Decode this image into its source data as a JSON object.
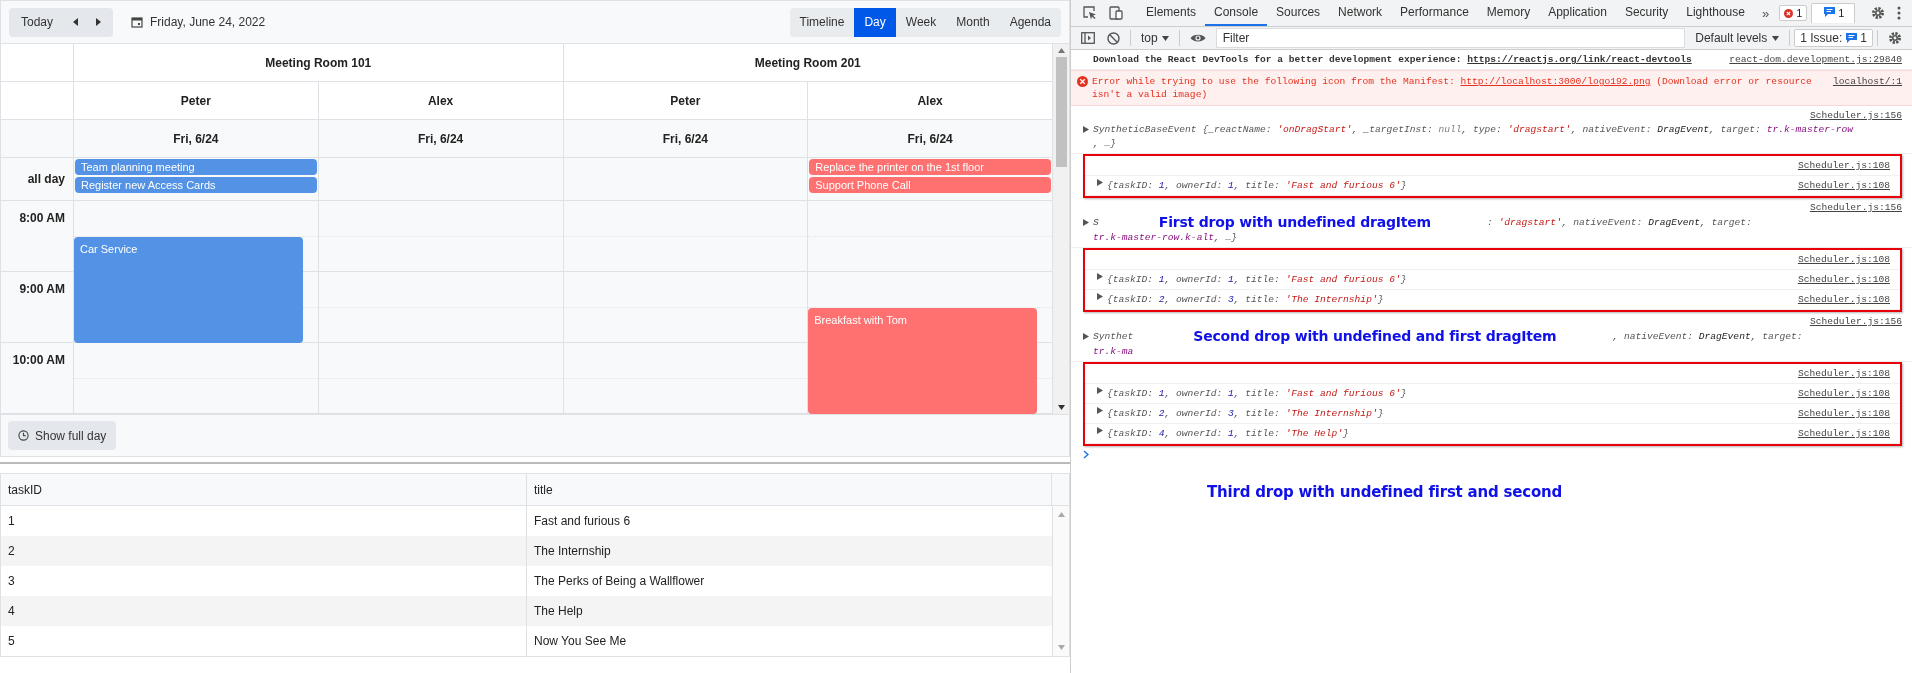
{
  "toolbar": {
    "today": "Today",
    "date": "Friday, June 24, 2022",
    "views": [
      {
        "label": "Timeline",
        "selected": false
      },
      {
        "label": "Day",
        "selected": true
      },
      {
        "label": "Week",
        "selected": false
      },
      {
        "label": "Month",
        "selected": false
      },
      {
        "label": "Agenda",
        "selected": false
      }
    ]
  },
  "scheduler": {
    "rooms": [
      "Meeting Room 101",
      "Meeting Room 201"
    ],
    "all_day_label": "all day",
    "times": [
      "8:00 AM",
      "9:00 AM",
      "10:00 AM"
    ],
    "show_full_day": "Show full day",
    "columns": [
      {
        "person": "Peter",
        "date": "Fri, 6/24",
        "all_day": [
          {
            "title": "Team planning meeting",
            "color": "#5392e4"
          },
          {
            "title": "Register new Access Cards",
            "color": "#5392e4"
          }
        ],
        "events": [
          {
            "title": "Car Service",
            "color": "#5392e4"
          }
        ]
      },
      {
        "person": "Alex",
        "date": "Fri, 6/24"
      },
      {
        "person": "Peter",
        "date": "Fri, 6/24"
      },
      {
        "person": "Alex",
        "date": "Fri, 6/24",
        "all_day": [
          {
            "title": "Replace the printer on the 1st floor",
            "color": "#ff7070"
          },
          {
            "title": "Support Phone Call",
            "color": "#ff7070"
          }
        ],
        "events": [
          {
            "title": "Breakfast with Tom",
            "color": "#ff7070"
          }
        ]
      }
    ]
  },
  "grid": {
    "columns": [
      "taskID",
      "title"
    ],
    "rows": [
      [
        "1",
        "Fast and furious 6"
      ],
      [
        "2",
        "The Internship"
      ],
      [
        "3",
        "The Perks of Being a Wallflower"
      ],
      [
        "4",
        "The Help"
      ],
      [
        "5",
        "Now You See Me"
      ]
    ]
  },
  "devtools": {
    "tabs": [
      {
        "label": "Elements",
        "selected": false
      },
      {
        "label": "Console",
        "selected": true
      },
      {
        "label": "Sources",
        "selected": false
      },
      {
        "label": "Network",
        "selected": false
      },
      {
        "label": "Performance",
        "selected": false
      },
      {
        "label": "Memory",
        "selected": false
      },
      {
        "label": "Application",
        "selected": false
      },
      {
        "label": "Security",
        "selected": false
      },
      {
        "label": "Lighthouse",
        "selected": false
      }
    ],
    "more": "»",
    "error_count": "1",
    "message_count": "1",
    "context": "top",
    "filter_placeholder": "Filter",
    "levels": "Default levels",
    "issues": "1 Issue:",
    "issue_count": "1",
    "groups": [
      {
        "highlighted": false,
        "messages": [
          {
            "kind": "info",
            "text": "Download the React DevTools for a better development experience: ",
            "link": "https://reactjs.org/link/react-devtools",
            "source": "react-dom.development.js:29840"
          },
          {
            "kind": "error",
            "text": "Error while trying to use the following icon from the Manifest: ",
            "link": "http://localhost:3000/logo192.png",
            "after": " (Download error or resource isn't a valid image)",
            "source": "localhost/:1"
          },
          {
            "kind": "event",
            "source": "Scheduler.js:156",
            "lines": [
              [
                {
                  "text": "SyntheticBaseEvent {_reactName: ",
                  "kind": "plain"
                },
                {
                  "text": "'onDragStart'",
                  "kind": "str"
                },
                {
                  "text": ", _targetInst: ",
                  "kind": "plain"
                },
                {
                  "text": "null",
                  "kind": "null"
                },
                {
                  "text": ", type: ",
                  "kind": "plain"
                },
                {
                  "text": "'dragstart'",
                  "kind": "str"
                },
                {
                  "text": ", nativeEvent: ",
                  "kind": "plain"
                },
                {
                  "text": "DragEvent",
                  "kind": "value"
                },
                {
                  "text": ", target: ",
                  "kind": "plain"
                },
                {
                  "text": "tr.k-master-row",
                  "kind": "node"
                }
              ],
              [
                {
                  "text": ", …}",
                  "kind": "plain"
                }
              ]
            ]
          }
        ]
      },
      {
        "highlighted": true,
        "messages": [
          {
            "kind": "empty",
            "source": "Scheduler.js:108"
          },
          {
            "kind": "object",
            "source": "Scheduler.js:108",
            "segments": [
              {
                "text": "{taskID: ",
                "kind": "plain"
              },
              {
                "text": "1",
                "kind": "num"
              },
              {
                "text": ", ownerId: ",
                "kind": "plain"
              },
              {
                "text": "1",
                "kind": "num"
              },
              {
                "text": ", title: ",
                "kind": "plain"
              },
              {
                "text": "'Fast and furious 6'",
                "kind": "str"
              },
              {
                "text": "}",
                "kind": "plain"
              }
            ]
          }
        ]
      },
      {
        "highlighted": false,
        "messages": [
          {
            "kind": "event",
            "source": "Scheduler.js:156",
            "lines": [
              [
                {
                  "text": "S",
                  "kind": "plain"
                },
                {
                  "text": "First drop with undefined dragItem",
                  "kind": "note"
                },
                {
                  "text": ": ",
                  "kind": "plain"
                },
                {
                  "text": "'dragstart'",
                  "kind": "str"
                },
                {
                  "text": ", nativeEvent: ",
                  "kind": "plain"
                },
                {
                  "text": "DragEvent",
                  "kind": "value"
                },
                {
                  "text": ", target:",
                  "kind": "plain"
                }
              ],
              [
                {
                  "text": "tr.k-master-row.k-alt",
                  "kind": "node"
                },
                {
                  "text": ", …}",
                  "kind": "plain"
                }
              ]
            ]
          }
        ]
      },
      {
        "highlighted": true,
        "messages": [
          {
            "kind": "empty",
            "source": "Scheduler.js:108"
          },
          {
            "kind": "object",
            "source": "Scheduler.js:108",
            "segments": [
              {
                "text": "{taskID: ",
                "kind": "plain"
              },
              {
                "text": "1",
                "kind": "num"
              },
              {
                "text": ", ownerId: ",
                "kind": "plain"
              },
              {
                "text": "1",
                "kind": "num"
              },
              {
                "text": ", title: ",
                "kind": "plain"
              },
              {
                "text": "'Fast and furious 6'",
                "kind": "str"
              },
              {
                "text": "}",
                "kind": "plain"
              }
            ]
          },
          {
            "kind": "object",
            "source": "Scheduler.js:108",
            "segments": [
              {
                "text": "{taskID: ",
                "kind": "plain"
              },
              {
                "text": "2",
                "kind": "num"
              },
              {
                "text": ", ownerId: ",
                "kind": "plain"
              },
              {
                "text": "3",
                "kind": "num"
              },
              {
                "text": ", title: ",
                "kind": "plain"
              },
              {
                "text": "'The Internship'",
                "kind": "str"
              },
              {
                "text": "}",
                "kind": "plain"
              }
            ]
          }
        ]
      },
      {
        "highlighted": false,
        "messages": [
          {
            "kind": "event",
            "source": "Scheduler.js:156",
            "lines": [
              [
                {
                  "text": "Synthet",
                  "kind": "plain"
                },
                {
                  "text": "Second drop with undefined and first dragItem",
                  "kind": "note"
                },
                {
                  "text": ", nativeEvent: ",
                  "kind": "plain"
                },
                {
                  "text": "DragEvent",
                  "kind": "value"
                },
                {
                  "text": ", target:",
                  "kind": "plain"
                }
              ],
              [
                {
                  "text": "tr.k-ma",
                  "kind": "node"
                }
              ]
            ]
          }
        ]
      },
      {
        "highlighted": true,
        "messages": [
          {
            "kind": "empty",
            "source": "Scheduler.js:108"
          },
          {
            "kind": "object",
            "source": "Scheduler.js:108",
            "segments": [
              {
                "text": "{taskID: ",
                "kind": "plain"
              },
              {
                "text": "1",
                "kind": "num"
              },
              {
                "text": ", ownerId: ",
                "kind": "plain"
              },
              {
                "text": "1",
                "kind": "num"
              },
              {
                "text": ", title: ",
                "kind": "plain"
              },
              {
                "text": "'Fast and furious 6'",
                "kind": "str"
              },
              {
                "text": "}",
                "kind": "plain"
              }
            ]
          },
          {
            "kind": "object",
            "source": "Scheduler.js:108",
            "segments": [
              {
                "text": "{taskID: ",
                "kind": "plain"
              },
              {
                "text": "2",
                "kind": "num"
              },
              {
                "text": ", ownerId: ",
                "kind": "plain"
              },
              {
                "text": "3",
                "kind": "num"
              },
              {
                "text": ", title: ",
                "kind": "plain"
              },
              {
                "text": "'The Internship'",
                "kind": "str"
              },
              {
                "text": "}",
                "kind": "plain"
              }
            ]
          },
          {
            "kind": "object",
            "source": "Scheduler.js:108",
            "segments": [
              {
                "text": "{taskID: ",
                "kind": "plain"
              },
              {
                "text": "4",
                "kind": "num"
              },
              {
                "text": ", ownerId: ",
                "kind": "plain"
              },
              {
                "text": "1",
                "kind": "num"
              },
              {
                "text": ", title: ",
                "kind": "plain"
              },
              {
                "text": "'The Help'",
                "kind": "str"
              },
              {
                "text": "}",
                "kind": "plain"
              }
            ]
          }
        ]
      }
    ],
    "footer_note": "Third drop with undefined first and second"
  }
}
